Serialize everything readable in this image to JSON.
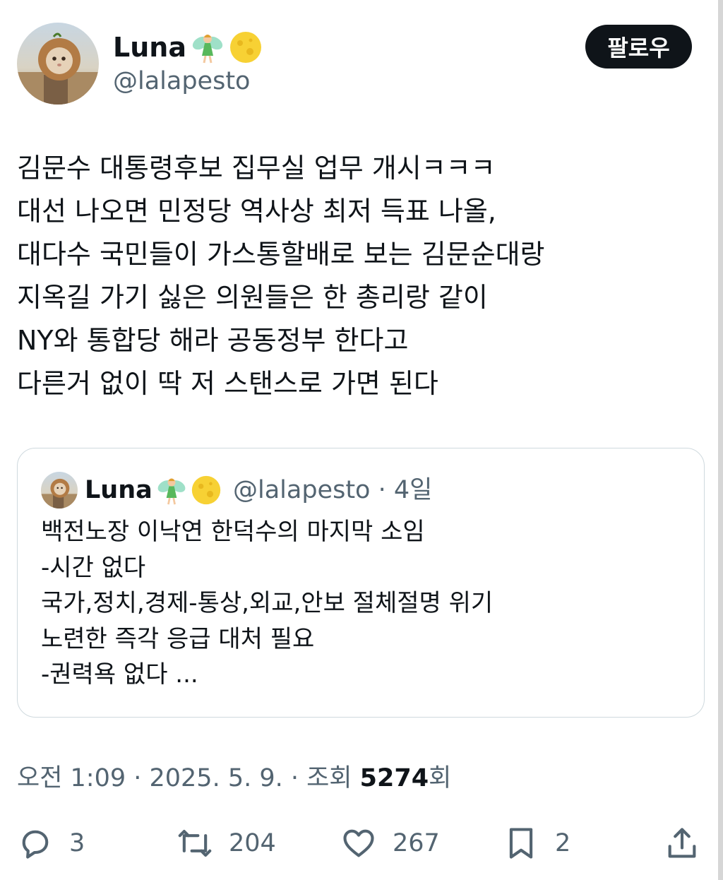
{
  "author": {
    "display_name": "Luna",
    "handle": "@lalapesto",
    "badges": [
      "fairy-emoji",
      "full-moon-emoji"
    ]
  },
  "follow_button_label": "팔로우",
  "tweet_lines": [
    "김문수 대통령후보 집무실 업무 개시ㅋㅋㅋ",
    "대선 나오면 민정당 역사상 최저 득표 나올,",
    "대다수 국민들이 가스통할배로 보는 김문순대랑",
    "지옥길 가기 싫은 의원들은 한 총리랑 같이",
    "NY와 통합당 해라 공동정부 한다고",
    "다른거 없이 딱 저 스탠스로 가면 된다"
  ],
  "quote": {
    "display_name": "Luna",
    "handle_time": "@lalapesto · 4일",
    "lines": [
      "백전노장 이낙연 한덕수의 마지막 소임",
      "-시간 없다",
      "국가,정치,경제-통상,외교,안보 절체절명 위기",
      "노련한 즉각 응급 대처 필요",
      "-권력욕 없다 ..."
    ]
  },
  "meta": {
    "time_date": "오전 1:09 · 2025. 5. 9. · 조회 ",
    "views": "5274",
    "views_suffix": "회"
  },
  "actions": {
    "reply_count": "3",
    "retweet_count": "204",
    "like_count": "267",
    "bookmark_count": "2"
  },
  "icons": [
    "reply-icon",
    "retweet-icon",
    "like-icon",
    "bookmark-icon",
    "share-icon"
  ],
  "colors": {
    "text": "#0f1419",
    "secondary": "#536471",
    "border": "#cfd9de",
    "button_bg": "#0f1419"
  }
}
